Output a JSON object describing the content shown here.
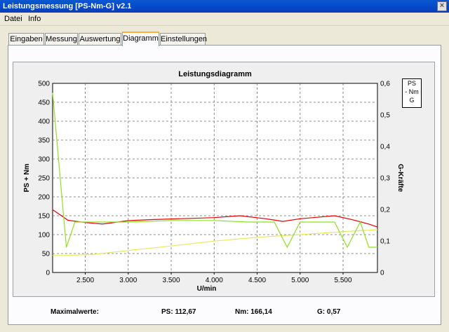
{
  "window": {
    "title": "Leistungsmessung [PS-Nm-G] v2.1",
    "close_glyph": "×"
  },
  "menu": {
    "items": [
      "Datei",
      "Info"
    ]
  },
  "tabs": [
    {
      "label": "Eingaben"
    },
    {
      "label": "Messung"
    },
    {
      "label": "Auswertung"
    },
    {
      "label": "Diagramm",
      "active": true
    },
    {
      "label": "Einstellungen"
    }
  ],
  "chart_data": {
    "type": "line",
    "title": "Leistungsdiagramm",
    "xlabel": "U/min",
    "ylabel": "PS + Nm",
    "y2label": "G-Kräfte",
    "xlim": [
      2120,
      5900
    ],
    "ylim": [
      0,
      500
    ],
    "y2lim": [
      0,
      0.6
    ],
    "x_ticks": [
      "2.500",
      "3.000",
      "3.500",
      "4.000",
      "4.500",
      "5.000",
      "5.500"
    ],
    "x_tick_values": [
      2500,
      3000,
      3500,
      4000,
      4500,
      5000,
      5500
    ],
    "y_ticks": [
      "0",
      "50",
      "100",
      "150",
      "200",
      "250",
      "300",
      "350",
      "400",
      "450",
      "500"
    ],
    "y_tick_values": [
      0,
      50,
      100,
      150,
      200,
      250,
      300,
      350,
      400,
      450,
      500
    ],
    "y2_ticks": [
      "0",
      "0,1",
      "0,2",
      "0,3",
      "0,4",
      "0,5",
      "0,6"
    ],
    "y2_tick_values": [
      0,
      0.1,
      0.2,
      0.3,
      0.4,
      0.5,
      0.6
    ],
    "grid": true,
    "legend_items": [
      "PS",
      "- Nm",
      "G"
    ],
    "series": [
      {
        "name": "Nm",
        "axis": "left",
        "color": "#e00000",
        "x": [
          2120,
          2300,
          2500,
          2700,
          3000,
          3300,
          3600,
          4000,
          4300,
          4600,
          4800,
          5000,
          5200,
          5400,
          5600,
          5800,
          5900
        ],
        "y": [
          166,
          138,
          132,
          128,
          137,
          140,
          142,
          145,
          150,
          142,
          135,
          142,
          146,
          150,
          140,
          128,
          120
        ]
      },
      {
        "name": "PS",
        "axis": "left",
        "color": "#e8e860",
        "x": [
          2120,
          2300,
          2600,
          3000,
          3500,
          4000,
          4500,
          5000,
          5500,
          5900
        ],
        "y": [
          45,
          45,
          48,
          58,
          70,
          83,
          93,
          100,
          108,
          113
        ]
      },
      {
        "name": "G",
        "axis": "right",
        "color": "#90e020",
        "x": [
          2120,
          2280,
          2380,
          2600,
          3000,
          3500,
          4000,
          4400,
          4700,
          4850,
          5000,
          5400,
          5550,
          5700,
          5800,
          5900
        ],
        "y": [
          0.57,
          0.08,
          0.16,
          0.16,
          0.16,
          0.165,
          0.165,
          0.16,
          0.16,
          0.08,
          0.16,
          0.16,
          0.08,
          0.16,
          0.08,
          0.08
        ]
      }
    ]
  },
  "stats": {
    "max_label": "Maximalwerte:",
    "ps": "PS: 112,67",
    "nm": "Nm: 166,14",
    "g": "G: 0,57"
  }
}
